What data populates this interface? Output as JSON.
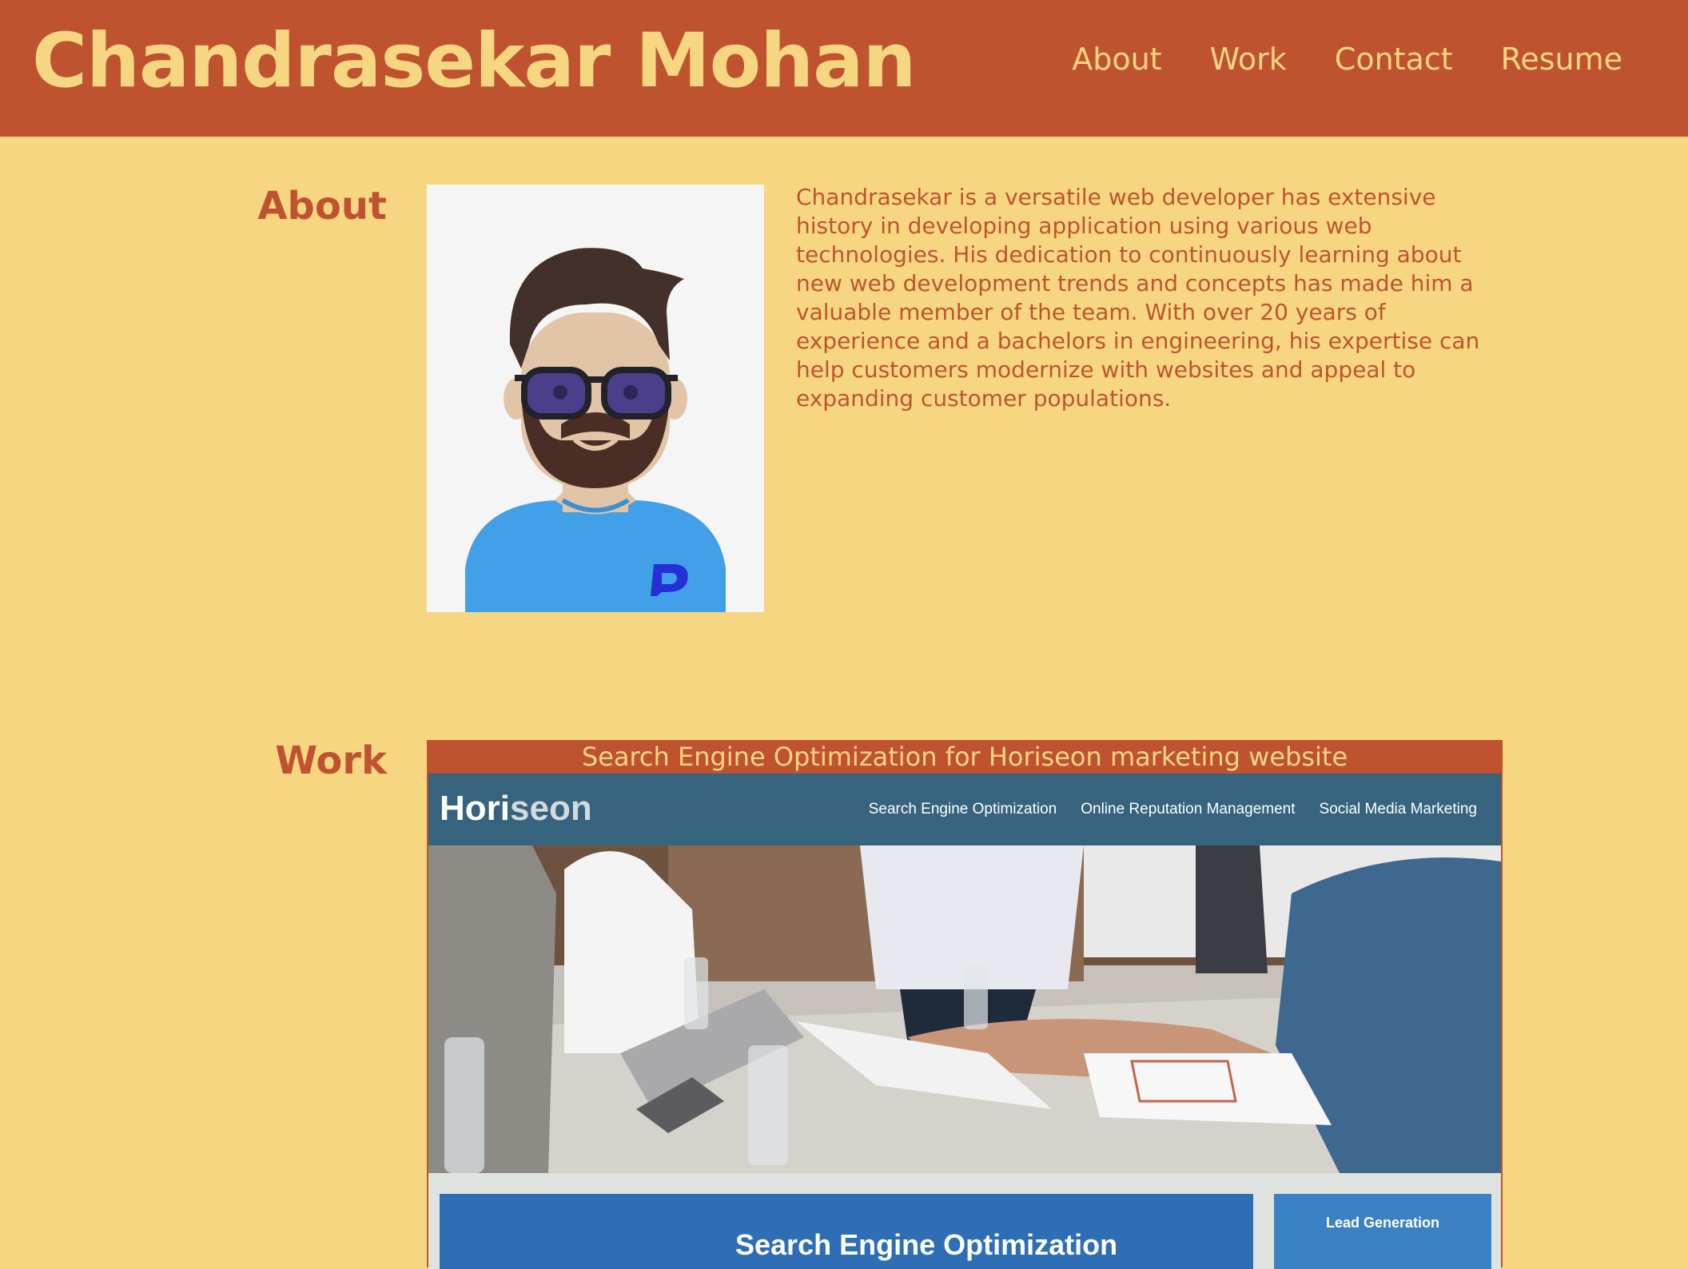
{
  "header": {
    "title": "Chandrasekar Mohan",
    "nav": [
      "About",
      "Work",
      "Contact",
      "Resume"
    ]
  },
  "about": {
    "heading": "About",
    "bio": "Chandrasekar is a versatile web developer has extensive history in developing application using various web technologies. His dedication to continuously learning about new web development trends and concepts has made him a valuable member of the team. With over 20 years of experience and a bachelors in engineering, his expertise can help customers modernize with websites and appeal to expanding customer populations."
  },
  "work": {
    "heading": "Work",
    "project": {
      "title": "Search Engine Optimization for Horiseon marketing website",
      "screenshot": {
        "logo_main": "Hori",
        "logo_accent": "seon",
        "nav": [
          "Search Engine Optimization",
          "Online Reputation Management",
          "Social Media Marketing"
        ],
        "content_title": "Search Engine Optimization",
        "sidebar_title": "Lead Generation"
      }
    }
  },
  "colors": {
    "header_bg": "#bf5330",
    "page_bg": "#f7d681",
    "accent_text": "#bf5330",
    "header_text": "#f7d681"
  },
  "icons": [
    "developer-avatar-icon"
  ]
}
